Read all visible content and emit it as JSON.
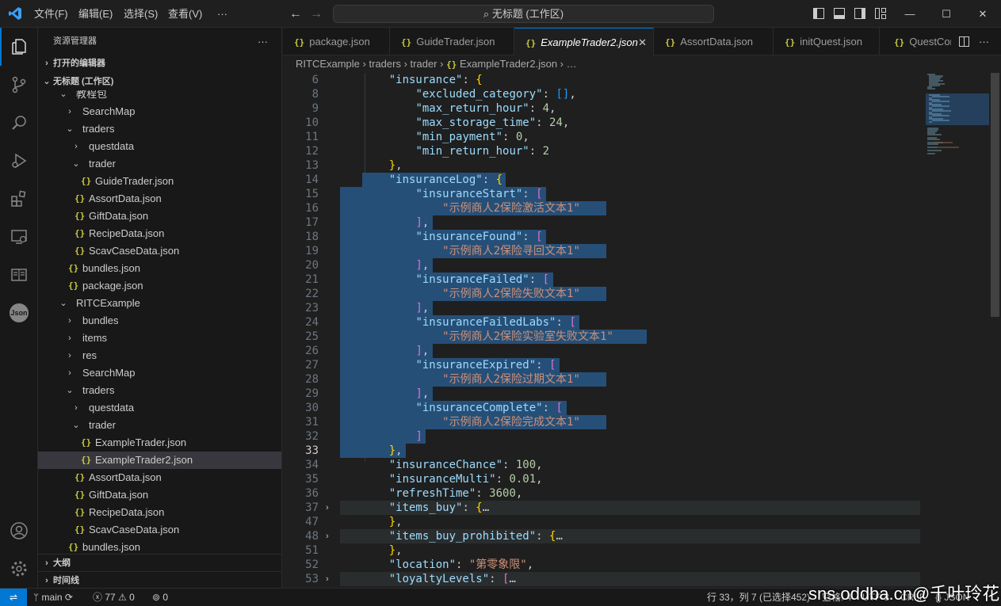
{
  "titlebar": {
    "menu": [
      "文件(F)",
      "编辑(E)",
      "选择(S)",
      "查看(V)",
      "···"
    ],
    "search": "无标题 (工作区)",
    "window_buttons": [
      "—",
      "☐",
      "✕"
    ]
  },
  "sidebar": {
    "title": "资源管理器",
    "more": "···",
    "sections": {
      "open_editors": "打开的编辑器",
      "workspace": "无标题 (工作区)",
      "outline": "大纲",
      "timeline": "时间线"
    },
    "tree": [
      {
        "label": "教程包",
        "type": "folder-open",
        "depth": 1
      },
      {
        "label": "SearchMap",
        "type": "folder-closed",
        "depth": 2
      },
      {
        "label": "traders",
        "type": "folder-open",
        "depth": 2
      },
      {
        "label": "questdata",
        "type": "folder-closed",
        "depth": 3
      },
      {
        "label": "trader",
        "type": "folder-open",
        "depth": 3
      },
      {
        "label": "GuideTrader.json",
        "type": "json",
        "depth": 4
      },
      {
        "label": "AssortData.json",
        "type": "json",
        "depth": 3
      },
      {
        "label": "GiftData.json",
        "type": "json",
        "depth": 3
      },
      {
        "label": "RecipeData.json",
        "type": "json",
        "depth": 3
      },
      {
        "label": "ScavCaseData.json",
        "type": "json",
        "depth": 3
      },
      {
        "label": "bundles.json",
        "type": "json",
        "depth": 2
      },
      {
        "label": "package.json",
        "type": "json",
        "depth": 2
      },
      {
        "label": "RITCExample",
        "type": "folder-open",
        "depth": 1
      },
      {
        "label": "bundles",
        "type": "folder-closed",
        "depth": 2
      },
      {
        "label": "items",
        "type": "folder-closed",
        "depth": 2
      },
      {
        "label": "res",
        "type": "folder-closed",
        "depth": 2
      },
      {
        "label": "SearchMap",
        "type": "folder-closed",
        "depth": 2
      },
      {
        "label": "traders",
        "type": "folder-open",
        "depth": 2
      },
      {
        "label": "questdata",
        "type": "folder-closed",
        "depth": 3
      },
      {
        "label": "trader",
        "type": "folder-open",
        "depth": 3
      },
      {
        "label": "ExampleTrader.json",
        "type": "json",
        "depth": 4
      },
      {
        "label": "ExampleTrader2.json",
        "type": "json",
        "depth": 4,
        "selected": true
      },
      {
        "label": "AssortData.json",
        "type": "json",
        "depth": 3
      },
      {
        "label": "GiftData.json",
        "type": "json",
        "depth": 3
      },
      {
        "label": "RecipeData.json",
        "type": "json",
        "depth": 3
      },
      {
        "label": "ScavCaseData.json",
        "type": "json",
        "depth": 3
      },
      {
        "label": "bundles.json",
        "type": "json",
        "depth": 2
      }
    ]
  },
  "tabs": [
    {
      "label": "package.json",
      "active": false
    },
    {
      "label": "GuideTrader.json",
      "active": false
    },
    {
      "label": "ExampleTrader2.json",
      "active": true
    },
    {
      "label": "AssortData.json",
      "active": false
    },
    {
      "label": "initQuest.json",
      "active": false
    },
    {
      "label": "QuestCor",
      "active": false
    }
  ],
  "breadcrumb": [
    "RITCExample",
    "traders",
    "trader",
    "ExampleTrader2.json",
    "…"
  ],
  "editor": {
    "current_line": "33",
    "lines": [
      {
        "n": "6",
        "tokens": [
          [
            "    ",
            ""
          ],
          [
            "\"insurance\"",
            "k"
          ],
          [
            ": ",
            ""
          ],
          [
            "{",
            "b1"
          ]
        ]
      },
      {
        "n": "8",
        "tokens": [
          [
            "        ",
            ""
          ],
          [
            "\"excluded_category\"",
            "k"
          ],
          [
            ": ",
            ""
          ],
          [
            "[]",
            "b3"
          ],
          [
            ",",
            ""
          ]
        ]
      },
      {
        "n": "9",
        "tokens": [
          [
            "        ",
            ""
          ],
          [
            "\"max_return_hour\"",
            "k"
          ],
          [
            ": ",
            ""
          ],
          [
            "4",
            "n"
          ],
          [
            ",",
            ""
          ]
        ]
      },
      {
        "n": "10",
        "tokens": [
          [
            "        ",
            ""
          ],
          [
            "\"max_storage_time\"",
            "k"
          ],
          [
            ": ",
            ""
          ],
          [
            "24",
            "n"
          ],
          [
            ",",
            ""
          ]
        ]
      },
      {
        "n": "11",
        "tokens": [
          [
            "        ",
            ""
          ],
          [
            "\"min_payment\"",
            "k"
          ],
          [
            ": ",
            ""
          ],
          [
            "0",
            "n"
          ],
          [
            ",",
            ""
          ]
        ]
      },
      {
        "n": "12",
        "tokens": [
          [
            "        ",
            ""
          ],
          [
            "\"min_return_hour\"",
            "k"
          ],
          [
            ": ",
            ""
          ],
          [
            "2",
            "n"
          ]
        ]
      },
      {
        "n": "13",
        "tokens": [
          [
            "    ",
            ""
          ],
          [
            "}",
            "b1"
          ],
          [
            ",",
            ""
          ]
        ]
      },
      {
        "n": "14",
        "tokens": [
          [
            "    ",
            ""
          ],
          [
            "\"insuranceLog\"",
            "k"
          ],
          [
            ": ",
            ""
          ],
          [
            "{",
            "b1"
          ]
        ]
      },
      {
        "n": "15",
        "tokens": [
          [
            "        ",
            ""
          ],
          [
            "\"insuranceStart\"",
            "k"
          ],
          [
            ": ",
            ""
          ],
          [
            "[",
            "b2"
          ]
        ]
      },
      {
        "n": "16",
        "tokens": [
          [
            "            ",
            ""
          ],
          [
            "\"示例商人2保险激活文本1\"",
            "s"
          ]
        ]
      },
      {
        "n": "17",
        "tokens": [
          [
            "        ",
            ""
          ],
          [
            "]",
            "b2"
          ],
          [
            ",",
            ""
          ]
        ]
      },
      {
        "n": "18",
        "tokens": [
          [
            "        ",
            ""
          ],
          [
            "\"insuranceFound\"",
            "k"
          ],
          [
            ": ",
            ""
          ],
          [
            "[",
            "b2"
          ]
        ]
      },
      {
        "n": "19",
        "tokens": [
          [
            "            ",
            ""
          ],
          [
            "\"示例商人2保险寻回文本1\"",
            "s"
          ]
        ]
      },
      {
        "n": "20",
        "tokens": [
          [
            "        ",
            ""
          ],
          [
            "]",
            "b2"
          ],
          [
            ",",
            ""
          ]
        ]
      },
      {
        "n": "21",
        "tokens": [
          [
            "        ",
            ""
          ],
          [
            "\"insuranceFailed\"",
            "k"
          ],
          [
            ": ",
            ""
          ],
          [
            "[",
            "b2"
          ]
        ]
      },
      {
        "n": "22",
        "tokens": [
          [
            "            ",
            ""
          ],
          [
            "\"示例商人2保险失败文本1\"",
            "s"
          ]
        ]
      },
      {
        "n": "23",
        "tokens": [
          [
            "        ",
            ""
          ],
          [
            "]",
            "b2"
          ],
          [
            ",",
            ""
          ]
        ]
      },
      {
        "n": "24",
        "tokens": [
          [
            "        ",
            ""
          ],
          [
            "\"insuranceFailedLabs\"",
            "k"
          ],
          [
            ": ",
            ""
          ],
          [
            "[",
            "b2"
          ]
        ]
      },
      {
        "n": "25",
        "tokens": [
          [
            "            ",
            ""
          ],
          [
            "\"示例商人2保险实验室失败文本1\"",
            "s"
          ]
        ]
      },
      {
        "n": "26",
        "tokens": [
          [
            "        ",
            ""
          ],
          [
            "]",
            "b2"
          ],
          [
            ",",
            ""
          ]
        ]
      },
      {
        "n": "27",
        "tokens": [
          [
            "        ",
            ""
          ],
          [
            "\"insuranceExpired\"",
            "k"
          ],
          [
            ": ",
            ""
          ],
          [
            "[",
            "b2"
          ]
        ]
      },
      {
        "n": "28",
        "tokens": [
          [
            "            ",
            ""
          ],
          [
            "\"示例商人2保险过期文本1\"",
            "s"
          ]
        ]
      },
      {
        "n": "29",
        "tokens": [
          [
            "        ",
            ""
          ],
          [
            "]",
            "b2"
          ],
          [
            ",",
            ""
          ]
        ]
      },
      {
        "n": "30",
        "tokens": [
          [
            "        ",
            ""
          ],
          [
            "\"insuranceComplete\"",
            "k"
          ],
          [
            ": ",
            ""
          ],
          [
            "[",
            "b2"
          ]
        ]
      },
      {
        "n": "31",
        "tokens": [
          [
            "            ",
            ""
          ],
          [
            "\"示例商人2保险完成文本1\"",
            "s"
          ]
        ]
      },
      {
        "n": "32",
        "tokens": [
          [
            "        ",
            ""
          ],
          [
            "]",
            "b2"
          ]
        ]
      },
      {
        "n": "33",
        "tokens": [
          [
            "    ",
            ""
          ],
          [
            "}",
            "b1"
          ],
          [
            ",",
            ""
          ]
        ]
      },
      {
        "n": "34",
        "tokens": [
          [
            "    ",
            ""
          ],
          [
            "\"insuranceChance\"",
            "k"
          ],
          [
            ": ",
            ""
          ],
          [
            "100",
            "n"
          ],
          [
            ",",
            ""
          ]
        ]
      },
      {
        "n": "35",
        "tokens": [
          [
            "    ",
            ""
          ],
          [
            "\"insuranceMulti\"",
            "k"
          ],
          [
            ": ",
            ""
          ],
          [
            "0.01",
            "n"
          ],
          [
            ",",
            ""
          ]
        ]
      },
      {
        "n": "36",
        "tokens": [
          [
            "    ",
            ""
          ],
          [
            "\"refreshTime\"",
            "k"
          ],
          [
            ": ",
            ""
          ],
          [
            "3600",
            "n"
          ],
          [
            ",",
            ""
          ]
        ]
      },
      {
        "n": "37",
        "tokens": [
          [
            "    ",
            ""
          ],
          [
            "\"items_buy\"",
            "k"
          ],
          [
            ": ",
            ""
          ],
          [
            "{",
            "b1"
          ],
          [
            "…",
            ""
          ]
        ],
        "fold": true
      },
      {
        "n": "47",
        "tokens": [
          [
            "    ",
            ""
          ],
          [
            "}",
            "b1"
          ],
          [
            ",",
            ""
          ]
        ]
      },
      {
        "n": "48",
        "tokens": [
          [
            "    ",
            ""
          ],
          [
            "\"items_buy_prohibited\"",
            "k"
          ],
          [
            ": ",
            ""
          ],
          [
            "{",
            "b1"
          ],
          [
            "…",
            ""
          ]
        ],
        "fold": true
      },
      {
        "n": "51",
        "tokens": [
          [
            "    ",
            ""
          ],
          [
            "}",
            "b1"
          ],
          [
            ",",
            ""
          ]
        ]
      },
      {
        "n": "52",
        "tokens": [
          [
            "    ",
            ""
          ],
          [
            "\"location\"",
            "k"
          ],
          [
            ": ",
            ""
          ],
          [
            "\"第零象限\"",
            "s"
          ],
          [
            ",",
            ""
          ]
        ]
      },
      {
        "n": "53",
        "tokens": [
          [
            "    ",
            ""
          ],
          [
            "\"loyaltyLevels\"",
            "k"
          ],
          [
            ": ",
            ""
          ],
          [
            "[",
            "b2"
          ],
          [
            "…",
            ""
          ]
        ],
        "fold": true
      }
    ]
  },
  "statusbar": {
    "branch": "main",
    "errors": "77",
    "warnings": "0",
    "ports": "0",
    "position": "行 33，列 7 (已选择452)",
    "spaces": "空格: 4",
    "encoding": "UTF-8",
    "eol": "CRLF",
    "language": "JSON"
  },
  "watermark": "sns.oddba.cn@千叶玲花",
  "colors": {
    "accent": "#0078d4",
    "selection": "#264f78",
    "json_icon": "#cbcb41"
  }
}
